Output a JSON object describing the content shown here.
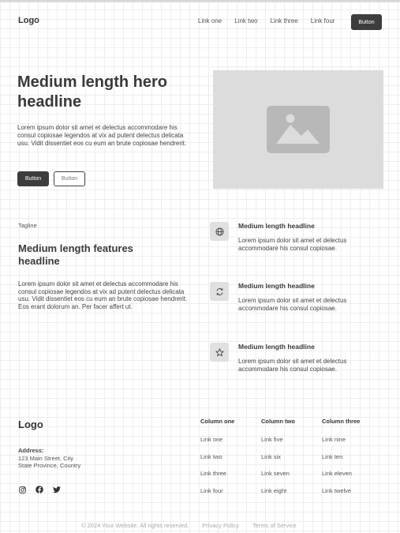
{
  "nav": {
    "logo": "Logo",
    "links": [
      "Link one",
      "Link two",
      "Link three",
      "Link four"
    ],
    "button": "Button"
  },
  "hero": {
    "title": "Medium length hero headline",
    "description": "Lorem ipsum dolor sit amet et delectus accommodare his consul copiosae legendos at vix ad putent delectus delicata usu. Vidit dissentiet eos cu eum an brute copiosae hendrerit.",
    "primary_button": "Button",
    "secondary_button": "Button",
    "image_icon": "image-placeholder-icon"
  },
  "features": {
    "tagline": "Tagline",
    "title": "Medium length features headline",
    "description": "Lorem ipsum dolor sit amet et delectus accommodare his consul copiosae legendos at vix ad putent delectus delicata usu. Vidit dissentiet eos cu eum an brute copiosae hendrerit. Eos erant dolorum an. Per facer affert ut.",
    "items": [
      {
        "icon": "globe-icon",
        "title": "Medium length headline",
        "description": "Lorem ipsum dolor sit amet et delectus accommodare his consul copiosae."
      },
      {
        "icon": "refresh-icon",
        "title": "Medium length headline",
        "description": "Lorem ipsum dolor sit amet et delectus accommodare his consul copiosae."
      },
      {
        "icon": "star-icon",
        "title": "Medium length headline",
        "description": "Lorem ipsum dolor sit amet et delectus accommodare his consul copiosae."
      }
    ]
  },
  "footer": {
    "logo": "Logo",
    "address_label": "Address:",
    "address_line1": "123 Main Street, City",
    "address_line2": "State Province, Country",
    "socials": [
      "instagram-icon",
      "facebook-icon",
      "twitter-icon"
    ],
    "columns": [
      {
        "title": "Column one",
        "links": [
          "Link one",
          "Link two",
          "Link three",
          "Link four"
        ]
      },
      {
        "title": "Column two",
        "links": [
          "Link five",
          "Link six",
          "Link seven",
          "Link eight"
        ]
      },
      {
        "title": "Column three",
        "links": [
          "Link nine",
          "Link ten",
          "Link eleven",
          "Link twelve"
        ]
      }
    ],
    "copyright": "© 2024 Your Website. All rights reserved.",
    "privacy": "Privacy Policy",
    "terms": "Terms of Service"
  }
}
